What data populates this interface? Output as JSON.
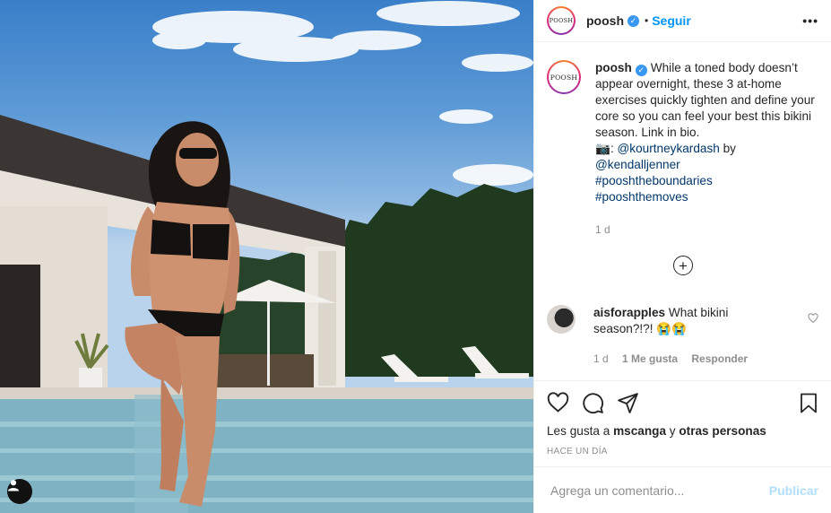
{
  "post": {
    "username": "poosh",
    "avatar_text": "POOSH",
    "follow_label": "Seguir",
    "separator": "•",
    "more_label": "•••",
    "caption": {
      "username": "poosh",
      "text": "While a toned body doesn’t appear overnight, these 3 at-home exercises quickly tighten and define your core so you can feel your best this bikini season. Link in bio.",
      "camera_emoji": "📷",
      "credit_sep": ": ",
      "credit_user": "@kourtneykardash",
      "by_word": " by",
      "credit_by": "@kendalljenner",
      "hashtags": [
        "#pooshtheboundaries",
        "#pooshthemoves"
      ],
      "time": "1 d"
    },
    "comment": {
      "username": "aisforapples",
      "text": "What bikini season?!?!",
      "emojis": "😭😭",
      "time": "1 d",
      "likes": "1 Me gusta",
      "reply": "Responder"
    },
    "likes_prefix": "Les gusta a",
    "likes_user": "mscanga",
    "likes_joiner": "y",
    "likes_suffix": "otras personas",
    "posted_ago": "HACE UN DÍA",
    "comment_placeholder": "Agrega un comentario...",
    "publish_label": "Publicar"
  },
  "icons": [
    "verified-icon",
    "more-icon",
    "load-more-icon",
    "heart-icon",
    "comment-icon",
    "share-icon",
    "save-icon",
    "tag-user-icon"
  ]
}
